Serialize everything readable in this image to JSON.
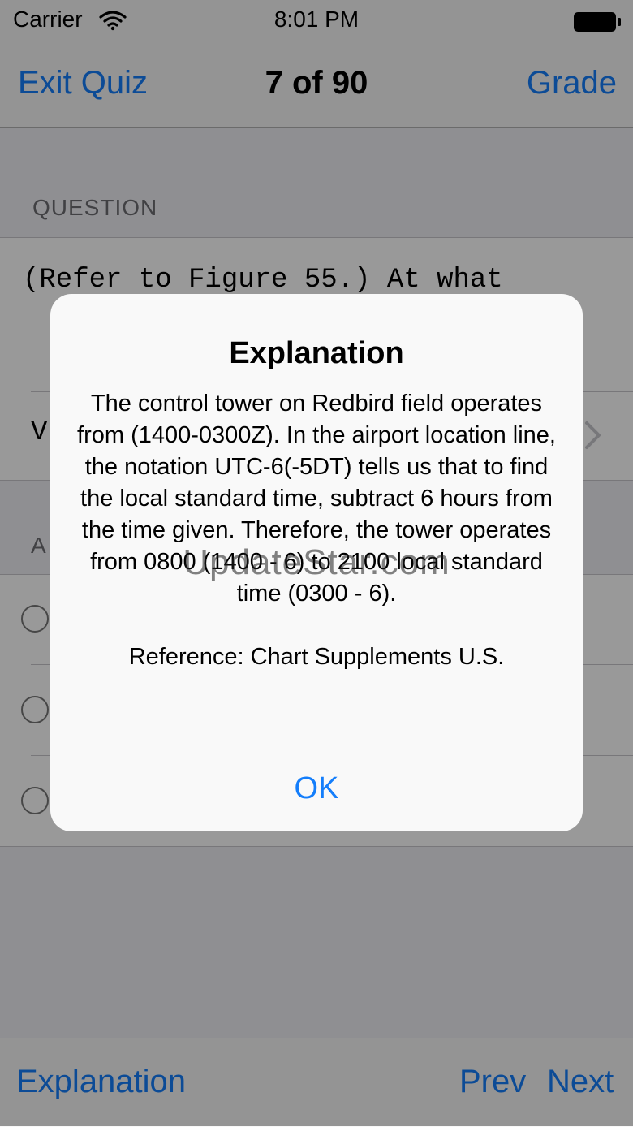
{
  "status_bar": {
    "carrier": "Carrier",
    "time": "8:01 PM"
  },
  "nav": {
    "left_button": "Exit Quiz",
    "title": "7 of 90",
    "right_button": "Grade"
  },
  "question": {
    "header": "QUESTION",
    "text_fragment": "(Refer to Figure 55.) At what",
    "figure_row_label": "V"
  },
  "answers": {
    "header": "A"
  },
  "toolbar": {
    "explanation": "Explanation",
    "prev": "Prev",
    "next": "Next"
  },
  "alert": {
    "title": "Explanation",
    "message": "The control tower on Redbird field operates from (1400-0300Z). In the airport location line, the notation UTC-6(-5DT) tells us that to find the local standard time, subtract 6 hours from the time given. Therefore, the tower operates from 0800 (1400 - 6) to 2100 local standard time (0300 - 6).\n\nReference: Chart Supplements U.S.",
    "ok": "OK"
  },
  "watermark": "UpdateStar.com",
  "colors": {
    "tint": "#147efb",
    "background": "#efeff4"
  }
}
